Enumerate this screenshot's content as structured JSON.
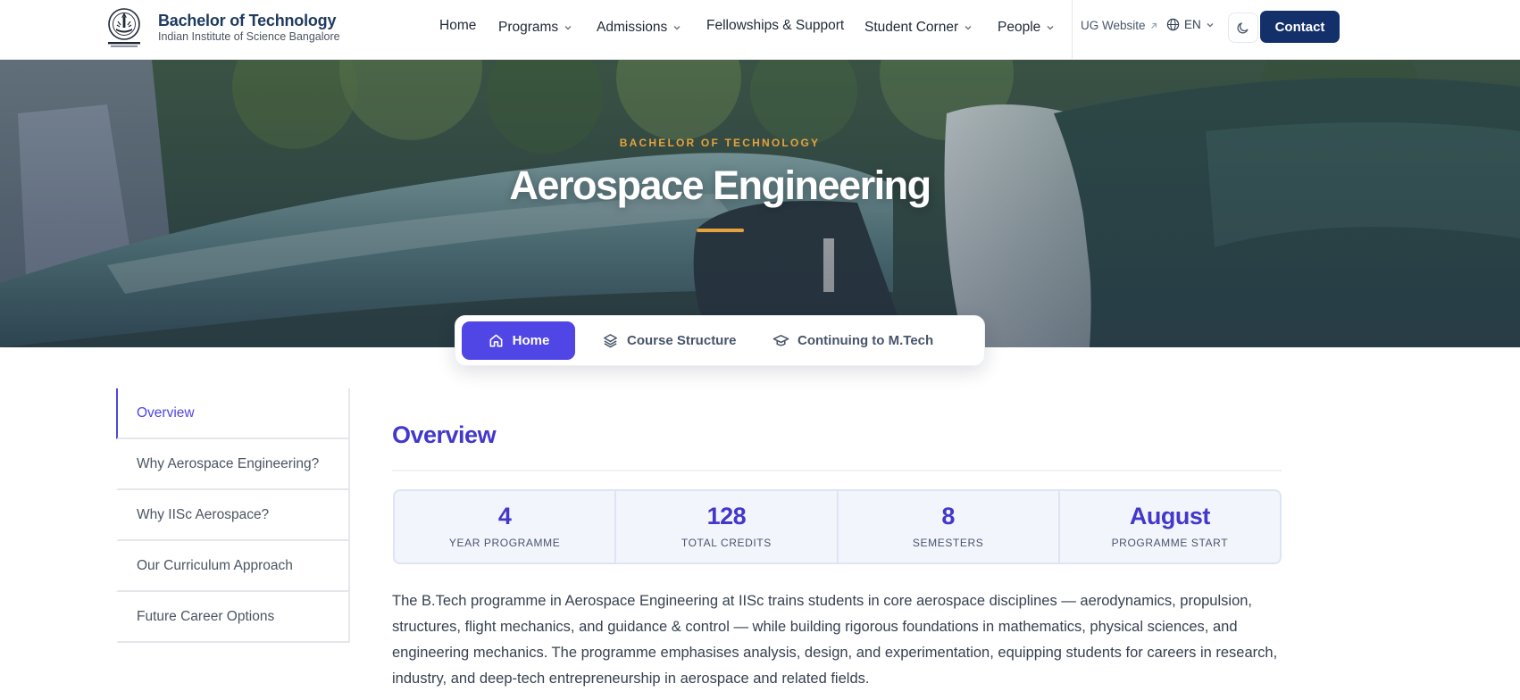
{
  "header": {
    "brand_title": "Bachelor of Technology",
    "brand_subtitle": "Indian Institute of Science Bangalore",
    "nav": [
      {
        "label": "Home",
        "has_dropdown": false
      },
      {
        "label": "Programs",
        "has_dropdown": true
      },
      {
        "label": "Admissions",
        "has_dropdown": true
      },
      {
        "label": "Fellowships & Support",
        "has_dropdown": false
      },
      {
        "label": "Student Corner",
        "has_dropdown": true
      },
      {
        "label": "People",
        "has_dropdown": true
      }
    ],
    "ug_website_label": "UG Website",
    "language": "EN",
    "theme_icon": "moon-icon",
    "contact_label": "Contact"
  },
  "hero": {
    "eyebrow": "BACHELOR OF TECHNOLOGY",
    "title": "Aerospace Engineering"
  },
  "tabs": [
    {
      "label": "Home",
      "icon": "home-icon",
      "active": true
    },
    {
      "label": "Course Structure",
      "icon": "layers-icon",
      "active": false
    },
    {
      "label": "Continuing to M.Tech",
      "icon": "graduation-cap-icon",
      "active": false
    }
  ],
  "sidebar": {
    "items": [
      {
        "label": "Overview",
        "active": true
      },
      {
        "label": "Why Aerospace Engineering?",
        "active": false
      },
      {
        "label": "Why IISc Aerospace?",
        "active": false
      },
      {
        "label": "Our Curriculum Approach",
        "active": false
      },
      {
        "label": "Future Career Options",
        "active": false
      }
    ]
  },
  "main": {
    "section_title": "Overview",
    "stats": [
      {
        "value": "4",
        "label": "YEAR PROGRAMME"
      },
      {
        "value": "128",
        "label": "TOTAL CREDITS"
      },
      {
        "value": "8",
        "label": "SEMESTERS"
      },
      {
        "value": "August",
        "label": "PROGRAMME START"
      }
    ],
    "paragraph": "The B.Tech programme in Aerospace Engineering at IISc trains students in core aerospace disciplines — aerodynamics, propulsion, structures, flight mechanics, and guidance & control — while building rigorous foundations in mathematics, physical sciences, and engineering mechanics. The programme emphasises analysis, design, and experimentation, equipping students for careers in research, industry, and deep-tech entrepreneurship in aerospace and related fields."
  },
  "colors": {
    "accent": "#4f46e5",
    "accent_text": "#4338ca",
    "brand_navy": "#14306b",
    "eyebrow_orange": "#e6a23c"
  }
}
